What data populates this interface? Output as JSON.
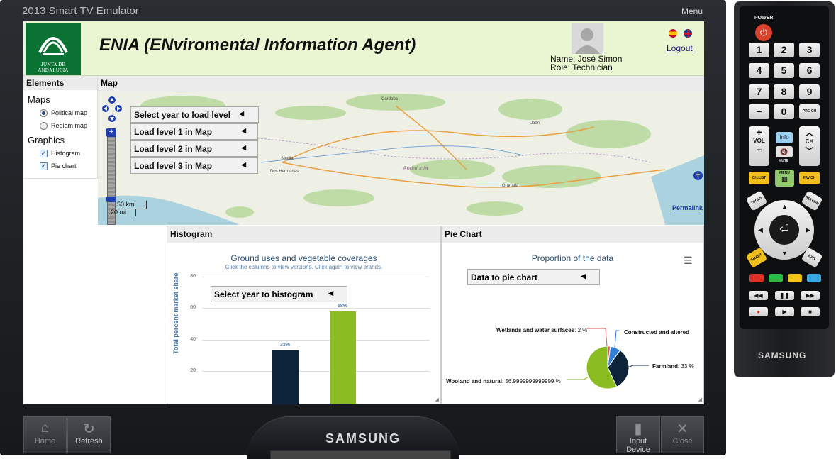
{
  "emulator": {
    "title": "2013 Smart TV Emulator",
    "menu_label": "Menu",
    "brand": "SAMSUNG",
    "home_label": "Home",
    "refresh_label": "Refresh",
    "input_device_label": "Input Device",
    "close_label": "Close"
  },
  "header": {
    "logo_text": "JUNTA DE ANDALUCIA",
    "app_title": "ENIA (ENviromental Information Agent)",
    "user_name": "Name: José Simon",
    "user_role": "Role: Technician",
    "logout_label": "Logout"
  },
  "elements_panel": {
    "title": "Elements",
    "maps_heading": "Maps",
    "maps_options": [
      {
        "label": "Political map",
        "selected": true
      },
      {
        "label": "Rediam map",
        "selected": false
      }
    ],
    "graphics_heading": "Graphics",
    "graphics_options": [
      {
        "label": "Histogram",
        "checked": true
      },
      {
        "label": "Pie chart",
        "checked": true
      }
    ]
  },
  "map_panel": {
    "title": "Map",
    "buttons": [
      "Select year to load level",
      "Load level 1 in Map",
      "Load level 2 in Map",
      "Load level 3 in Map"
    ],
    "scale_km": "50 km",
    "scale_mi": "20 mi",
    "permalink_label": "Permalink",
    "place_labels": [
      "Córdoba",
      "Sevilla",
      "Dos Hermanas",
      "Andalucía",
      "Granada",
      "Jaén"
    ]
  },
  "histogram": {
    "panel_title": "Histogram",
    "chart_title": "Ground uses and vegetable coverages",
    "chart_subtitle": "Click the columns to view versions. Click again to view brands.",
    "select_label": "Select year to histogram",
    "chart_data": {
      "type": "bar",
      "ylabel": "Total percent market share",
      "yticks": [
        "80",
        "60",
        "40",
        "20"
      ],
      "ylim": [
        0,
        80
      ],
      "values": [
        33,
        58
      ],
      "value_labels": [
        "33%",
        "58%"
      ],
      "colors": [
        "#0d233a",
        "#8bbc21"
      ]
    }
  },
  "pie_chart": {
    "panel_title": "Pie Chart",
    "chart_title": "Proportion of the data",
    "menu_icon": "hamburger-icon",
    "select_label": "Data to pie chart",
    "chart_data": {
      "type": "pie",
      "slices": [
        {
          "name": "Wetlands and water surfaces",
          "value": 2,
          "label": "2 %",
          "color": "#d65b5b"
        },
        {
          "name": "Constructed and altered",
          "value": 8,
          "label": "",
          "color": "#2f7ed8"
        },
        {
          "name": "Farmland",
          "value": 33,
          "label": "33 %",
          "color": "#0d233a"
        },
        {
          "name": "Wooland and natural",
          "value": 56.9999999999999,
          "label": "56.9999999999999 %",
          "color": "#8bbc21"
        }
      ]
    }
  },
  "remote": {
    "power_label": "POWER",
    "number_keys": [
      "1",
      "2",
      "3",
      "4",
      "5",
      "6",
      "7",
      "8",
      "9",
      "−",
      "0",
      "PRE-CH"
    ],
    "vol_label": "VOL",
    "ch_label": "CH",
    "info_label": "Info",
    "mute_label": "MUTE",
    "chlist_label": "CH.LIST",
    "menu_label": "MENU",
    "favch_label": "FAV.CH",
    "tools_label": "TOOLS",
    "return_label": "RETURN",
    "smarthub_label": "SMART HUB",
    "exit_label": "EXIT",
    "color_keys": [
      "#e0302a",
      "#2eb84a",
      "#f0c419",
      "#3aa7e0"
    ],
    "brand": "SAMSUNG"
  }
}
